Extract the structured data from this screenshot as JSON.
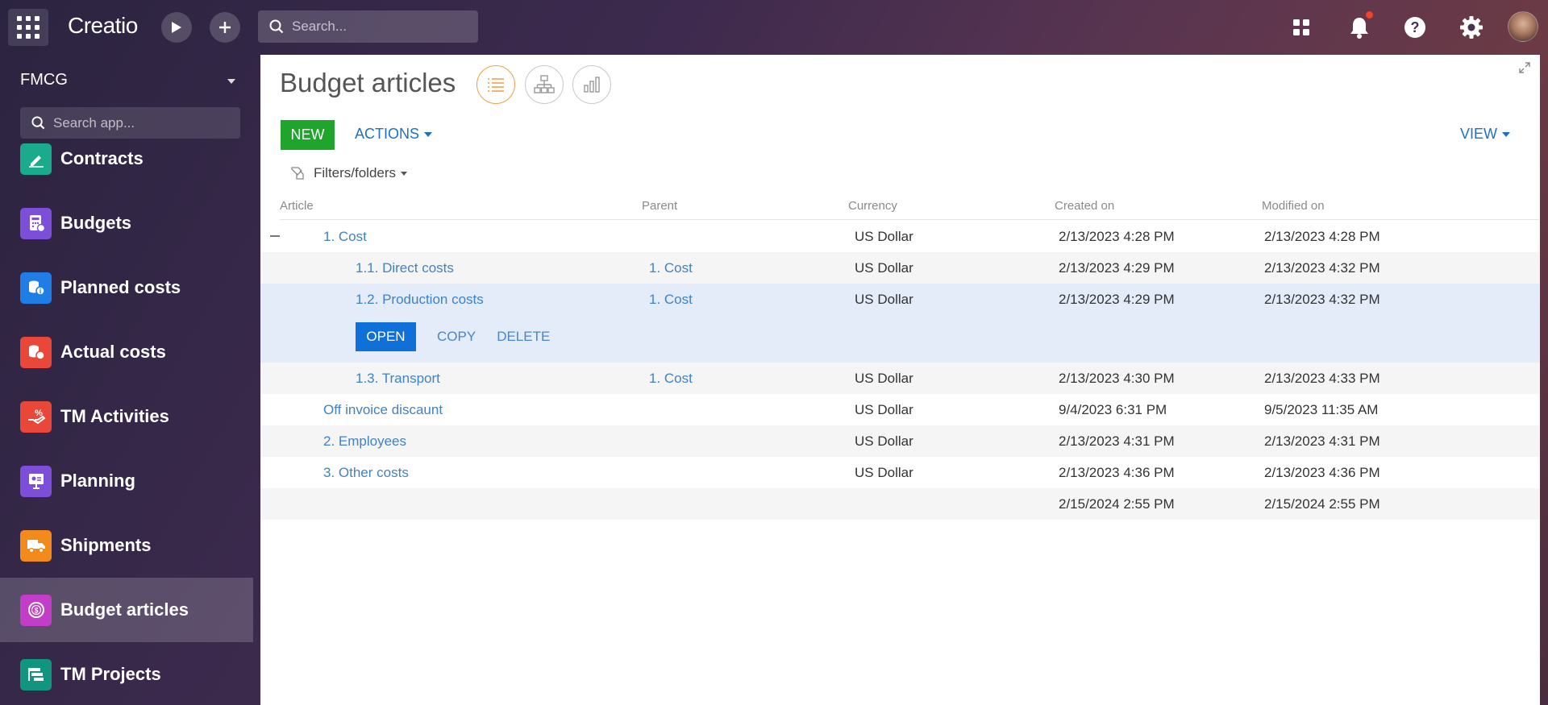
{
  "app": {
    "logo": "Creatio",
    "search_placeholder": "Search..."
  },
  "sidebar": {
    "workspace": "FMCG",
    "search_placeholder": "Search app...",
    "items": [
      {
        "label": "Contracts",
        "icon": "contract-icon",
        "color": "#1aaa8c"
      },
      {
        "label": "Budgets",
        "icon": "budget-calculator-icon",
        "color": "#7d4fd9"
      },
      {
        "label": "Planned costs",
        "icon": "planned-costs-icon",
        "color": "#1e7ee6"
      },
      {
        "label": "Actual costs",
        "icon": "actual-costs-icon",
        "color": "#e8473a"
      },
      {
        "label": "TM Activities",
        "icon": "tm-activities-icon",
        "color": "#e8473a"
      },
      {
        "label": "Planning",
        "icon": "planning-icon",
        "color": "#7d4fd9"
      },
      {
        "label": "Shipments",
        "icon": "truck-icon",
        "color": "#f28a1c"
      },
      {
        "label": "Budget articles",
        "icon": "budget-article-icon",
        "color": "#c23ec9"
      },
      {
        "label": "TM Projects",
        "icon": "tm-projects-icon",
        "color": "#12957f"
      }
    ]
  },
  "page": {
    "title": "Budget articles",
    "new_label": "NEW",
    "actions_label": "ACTIONS",
    "view_label": "VIEW",
    "filters_label": "Filters/folders"
  },
  "table": {
    "headers": [
      "Article",
      "Parent",
      "Currency",
      "Created on",
      "Modified on"
    ],
    "rows": [
      {
        "article": "1. Cost",
        "parent": "",
        "currency": "US Dollar",
        "created": "2/13/2023 4:28 PM",
        "modified": "2/13/2023 4:28 PM"
      },
      {
        "article": "1.1. Direct costs",
        "parent": "1. Cost",
        "currency": "US Dollar",
        "created": "2/13/2023 4:29 PM",
        "modified": "2/13/2023 4:32 PM"
      },
      {
        "article": "1.2. Production costs",
        "parent": "1. Cost",
        "currency": "US Dollar",
        "created": "2/13/2023 4:29 PM",
        "modified": "2/13/2023 4:32 PM"
      },
      {
        "article": "1.3. Transport",
        "parent": "1. Cost",
        "currency": "US Dollar",
        "created": "2/13/2023 4:30 PM",
        "modified": "2/13/2023 4:33 PM"
      },
      {
        "article": "Off invoice discaunt",
        "parent": "",
        "currency": "US Dollar",
        "created": "9/4/2023 6:31 PM",
        "modified": "9/5/2023 11:35 AM"
      },
      {
        "article": "2. Employees",
        "parent": "",
        "currency": "US Dollar",
        "created": "2/13/2023 4:31 PM",
        "modified": "2/13/2023 4:31 PM"
      },
      {
        "article": "3. Other costs",
        "parent": "",
        "currency": "US Dollar",
        "created": "2/13/2023 4:36 PM",
        "modified": "2/13/2023 4:36 PM"
      },
      {
        "article": "",
        "parent": "",
        "currency": "",
        "created": "2/15/2024 2:55 PM",
        "modified": "2/15/2024 2:55 PM"
      }
    ],
    "row_actions": {
      "open": "OPEN",
      "copy": "COPY",
      "delete": "DELETE"
    }
  },
  "colors": {
    "new_button": "#1fa52c",
    "open_button": "#0f70d9",
    "link": "#3f82c8",
    "selected_row": "#e4ebf9",
    "active_view": "#f29c48"
  }
}
